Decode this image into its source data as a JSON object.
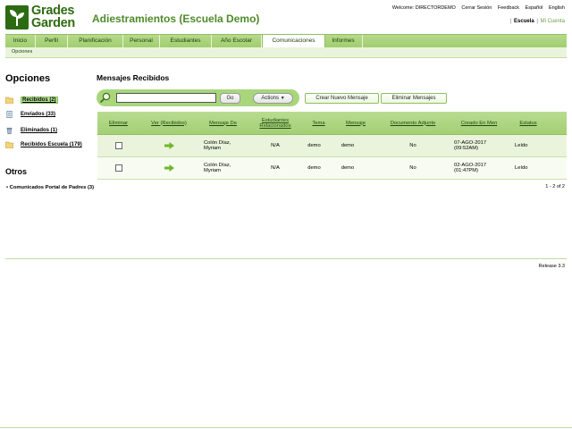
{
  "logo": {
    "line1": "Grades",
    "line2": "Garden"
  },
  "school_name": "Adiestramientos (Escuela Demo)",
  "top_links": [
    "Welcome: DIRECTORDEMO",
    "Cerrar Sesión",
    "Feedback",
    "Español",
    "English"
  ],
  "account": {
    "school_label": "Escuela",
    "account_label": "Mi Cuenta"
  },
  "nav": {
    "tabs": [
      "Inicio",
      "Perfil",
      "Planificación",
      "Personal",
      "Estudiantes",
      "Año Escolar",
      "Comunicaciones",
      "Informes"
    ],
    "active": "Comunicaciones"
  },
  "subnav": {
    "label": "Opciones"
  },
  "sidebar": {
    "title": "Opciones",
    "items": [
      {
        "label": "Recibidos (2)",
        "icon": "folder-icon"
      },
      {
        "label": "Enviados (33)",
        "icon": "document-icon"
      },
      {
        "label": "Eliminados (1)",
        "icon": "trash-icon"
      },
      {
        "label": "Recibidos Escuela (179)",
        "icon": "folder-icon"
      }
    ],
    "otros_title": "Otros",
    "otros_items": [
      "Comunicados Portal de Padres (3)"
    ]
  },
  "main": {
    "title": "Mensajes Recibidos",
    "search": {
      "value": "",
      "go_label": "Go",
      "actions_label": "Actions"
    },
    "buttons": {
      "new_message": "Crear Nuevo Mensaje",
      "delete_messages": "Eliminar Mensajes"
    }
  },
  "table": {
    "headers": [
      "Eliminar",
      "Ver (Recibidos)",
      "Mensaje De",
      "Estudiantes Relacionados",
      "Tema",
      "Mensaje",
      "Documento Adjunto",
      "Creado En Men",
      "Estatus"
    ],
    "rows": [
      {
        "from": "Colón Díaz, Myriam",
        "students": "N/A",
        "subject": "demo",
        "message": "demo",
        "attachment": "No",
        "created": "07-AGO-2017 (09:52AM)",
        "status": "Leído"
      },
      {
        "from": "Colón Díaz, Myriam",
        "students": "N/A",
        "subject": "demo",
        "message": "demo",
        "attachment": "No",
        "created": "02-AGO-2017 (01:47PM)",
        "status": "Leído"
      }
    ]
  },
  "pager": "1 - 2 of 2",
  "release": "Release 3.3",
  "colors": {
    "brand_green": "#2d6b12",
    "nav_green": "#a9d67b",
    "title_green": "#4f8a2a"
  }
}
